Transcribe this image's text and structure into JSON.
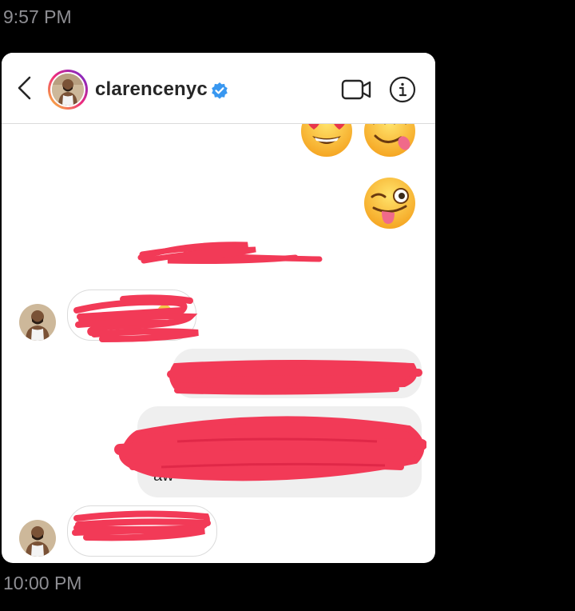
{
  "timestamps": {
    "top": "9:57 PM",
    "bottom": "10:00 PM"
  },
  "header": {
    "username": "clarencenyc",
    "verified": true,
    "back_icon": "chevron-left-icon",
    "video_icon": "video-camera-icon",
    "info_icon": "info-icon"
  },
  "messages": [
    {
      "type": "emoji",
      "from": "me",
      "emojis": [
        "heart-eyes-face",
        "savoring-food-face"
      ]
    },
    {
      "type": "emoji",
      "from": "me",
      "emojis": [
        "winking-tongue-face"
      ]
    },
    {
      "type": "redacted",
      "from": "me",
      "style": "plain"
    },
    {
      "type": "redacted",
      "from": "them",
      "style": "bubble"
    },
    {
      "type": "redacted",
      "from": "me",
      "style": "bubble"
    },
    {
      "type": "partially-redacted",
      "from": "me",
      "style": "bubble",
      "visible_fragment": "aw"
    },
    {
      "type": "redacted",
      "from": "them",
      "style": "bubble"
    }
  ],
  "colors": {
    "redaction": "#f23a57",
    "verified": "#3897f0",
    "bubble_out": "#efefef",
    "border": "#dbdbdb"
  }
}
